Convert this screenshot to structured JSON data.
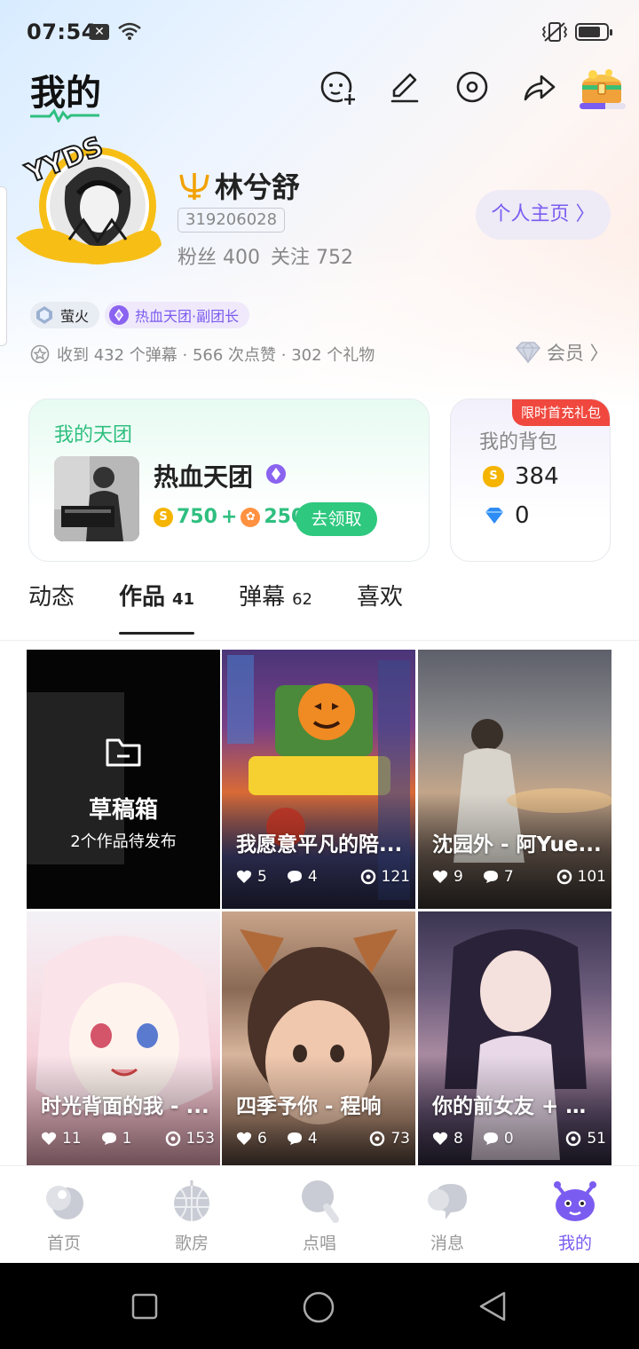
{
  "status_bar": {
    "time": "07:54"
  },
  "header": {
    "title": "我的",
    "chest_progress": 0.55
  },
  "profile": {
    "name": "林兮舒",
    "uid": "319206028",
    "fans_label": "粉丝 400",
    "follow_label": "关注 752",
    "home_button": "个人主页 〉"
  },
  "badges": {
    "firefly": "萤火",
    "team": "热血天团·副团长"
  },
  "received": "收到 432 个弹幕 · 566 次点赞 · 302 个礼物",
  "vip_label": "会员 〉",
  "team_card": {
    "title": "我的天团",
    "team_name": "热血天团",
    "coin_value": "750",
    "plus": "+",
    "flower_value": "250",
    "claim_button": "去领取"
  },
  "bag_card": {
    "title": "我的背包",
    "promo": "限时首充礼包",
    "coins": "384",
    "diamonds": "0"
  },
  "tabs": [
    {
      "label": "动态",
      "count": ""
    },
    {
      "label": "作品",
      "count": "41"
    },
    {
      "label": "弹幕",
      "count": "62"
    },
    {
      "label": "喜欢",
      "count": ""
    }
  ],
  "draft": {
    "title": "草稿箱",
    "subtitle": "2个作品待发布"
  },
  "works": [
    {
      "title": "我愿意平凡的陪...",
      "likes": "5",
      "comments": "4",
      "views": "121"
    },
    {
      "title": "沈园外 - 阿Yue...",
      "likes": "9",
      "comments": "7",
      "views": "101"
    },
    {
      "title": "时光背面的我 - ...",
      "likes": "11",
      "comments": "1",
      "views": "153"
    },
    {
      "title": "四季予你 - 程响",
      "likes": "6",
      "comments": "4",
      "views": "73"
    },
    {
      "title": "你的前女友 + 小...",
      "likes": "8",
      "comments": "0",
      "views": "51"
    }
  ],
  "bottom_nav": [
    "首页",
    "歌房",
    "点唱",
    "消息",
    "我的"
  ],
  "colors": {
    "accent": "#7b5cf0",
    "green": "#2ec87f",
    "promo_red": "#f0483e"
  }
}
